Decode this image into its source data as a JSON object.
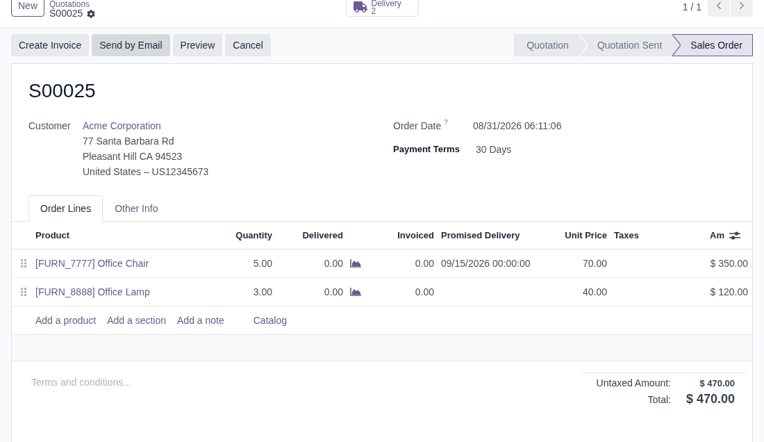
{
  "control_panel": {
    "new_button": "New",
    "breadcrumb": {
      "parent": "Quotations",
      "current": "S00025"
    },
    "smart_button": {
      "label": "Delivery",
      "count": "2"
    },
    "pager": "1 / 1"
  },
  "action_buttons": [
    {
      "label": "Create Invoice",
      "highlighted": false
    },
    {
      "label": "Send by Email",
      "highlighted": true
    },
    {
      "label": "Preview",
      "highlighted": false
    },
    {
      "label": "Cancel",
      "highlighted": false
    }
  ],
  "status_steps": [
    {
      "label": "Quotation",
      "selected": false
    },
    {
      "label": "Quotation Sent",
      "selected": false
    },
    {
      "label": "Sales Order",
      "selected": true
    }
  ],
  "record": {
    "title": "S00025",
    "left_fields": [
      {
        "kind": "partner",
        "label": "Customer",
        "value": "Acme Corporation",
        "address": [
          "77 Santa Barbara Rd",
          "Pleasant Hill CA 94523",
          "United States – US12345673"
        ]
      }
    ],
    "right_fields": [
      {
        "kind": "plain",
        "label": "Order Date",
        "help": "?",
        "value": "08/31/2026 06:11:06",
        "emphasized": false
      },
      {
        "kind": "plain",
        "label": "Payment Terms",
        "value": "30 Days",
        "emphasized": true
      }
    ]
  },
  "tabs": [
    {
      "label": "Order Lines",
      "selected": true
    },
    {
      "label": "Other Info",
      "selected": false
    }
  ],
  "order_lines": {
    "columns": [
      {
        "label": "Product",
        "kind": "text"
      },
      {
        "label": "Quantity",
        "kind": "number"
      },
      {
        "label": "Delivered",
        "kind": "forecast"
      },
      {
        "label": "Invoiced",
        "kind": "number"
      },
      {
        "label": "Promised Delivery",
        "kind": "text"
      },
      {
        "label": "Unit Price",
        "kind": "number"
      },
      {
        "label": "Taxes",
        "kind": "text"
      },
      {
        "label": "Am",
        "kind": "number"
      }
    ],
    "rows": [
      {
        "product": "[FURN_7777] Office Chair",
        "quantity": "5.00",
        "delivered": "0.00",
        "invoiced": "0.00",
        "promised_delivery": "09/15/2026 00:00:00",
        "unit_price": "70.00",
        "column_8": "$ 350.00"
      },
      {
        "product": "[FURN_8888] Office Lamp",
        "quantity": "3.00",
        "delivered": "0.00",
        "invoiced": "0.00",
        "unit_price": "40.00",
        "column_8": "$ 120.00"
      }
    ],
    "add_links": [
      {
        "label": "Add a product",
        "kind": "line"
      },
      {
        "label": "Add a section",
        "kind": "line"
      },
      {
        "label": "Add a note",
        "kind": "line"
      },
      {
        "label": "Catalog",
        "kind": "catalog"
      }
    ]
  },
  "terms": {
    "placeholder": "Terms and conditions..."
  },
  "totals": [
    {
      "kind": "subtotal",
      "label": "Untaxed Amount:",
      "value": "$ 470.00"
    },
    {
      "kind": "grand_total",
      "label": "Total:",
      "value": "$ 470.00"
    }
  ]
}
